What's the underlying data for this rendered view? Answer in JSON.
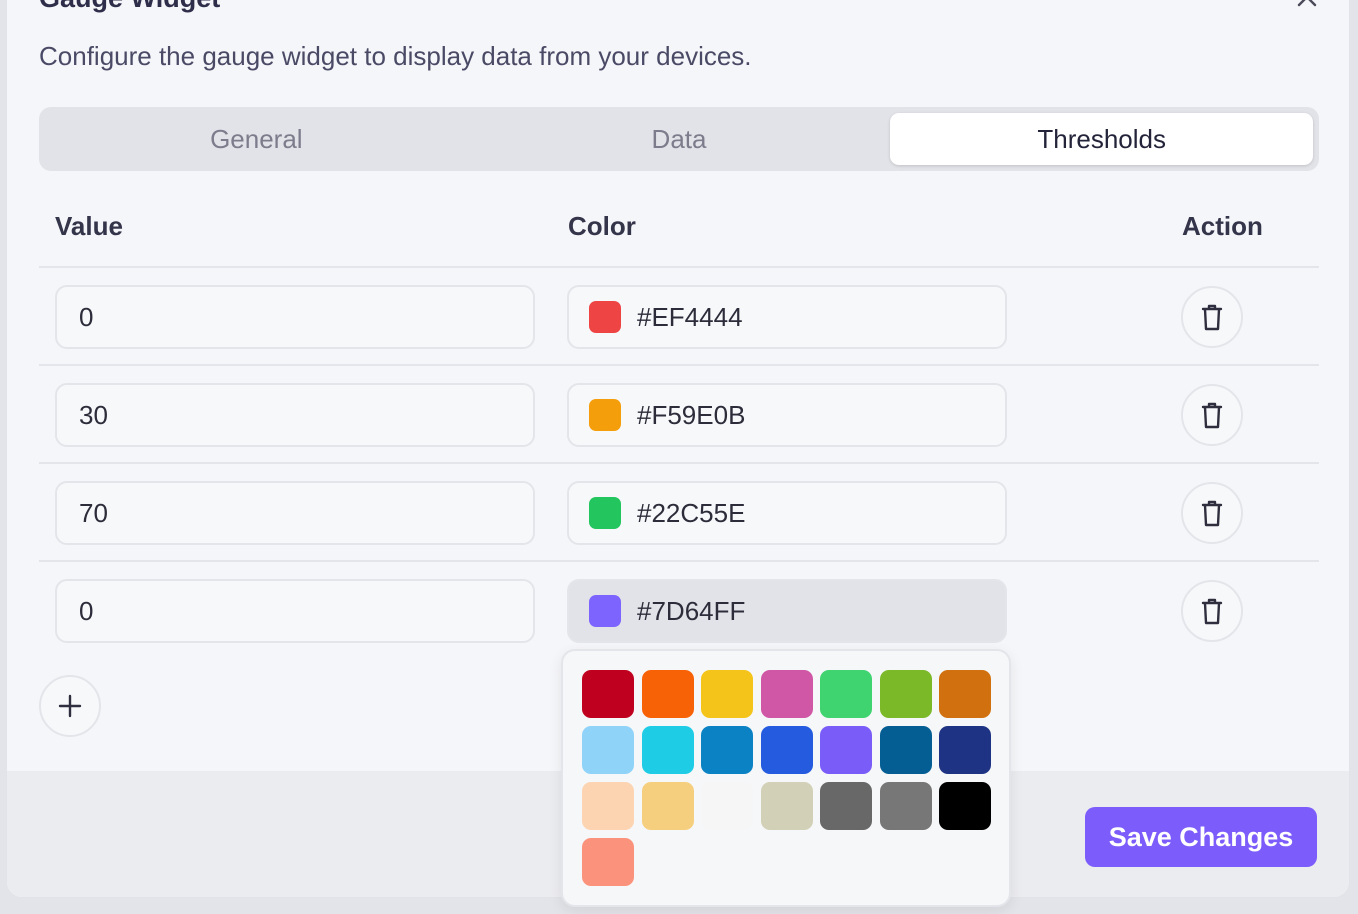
{
  "dialog": {
    "title": "Gauge Widget",
    "subtitle": "Configure the gauge widget to display data from your devices."
  },
  "tabs": [
    {
      "label": "General",
      "active": false
    },
    {
      "label": "Data",
      "active": false
    },
    {
      "label": "Thresholds",
      "active": true
    }
  ],
  "table": {
    "headers": {
      "value": "Value",
      "color": "Color",
      "action": "Action"
    },
    "rows": [
      {
        "value": "0",
        "color": "#EF4444",
        "color_label": "#EF4444"
      },
      {
        "value": "30",
        "color": "#F59E0B",
        "color_label": "#F59E0B"
      },
      {
        "value": "70",
        "color": "#22C55E",
        "color_label": "#22C55E"
      },
      {
        "value": "0",
        "color": "#7D64FF",
        "color_label": "#7D64FF"
      }
    ]
  },
  "palette": {
    "colors": [
      "#C0001F",
      "#F86207",
      "#F4C41A",
      "#CF57A6",
      "#3FD46F",
      "#7BB928",
      "#D1700E",
      "#8FD3F9",
      "#1FCCE6",
      "#0A82C4",
      "#245BDF",
      "#7A5DF9",
      "#045E93",
      "#1E3383",
      "#FDD4B1",
      "#F5CF7E",
      "#F6F6F7",
      "#D2D0B6",
      "#686868",
      "#777777",
      "#000000",
      "#FB937C"
    ]
  },
  "footer": {
    "save_label": "Save Changes"
  },
  "icons": {
    "close": "close-icon",
    "delete": "trash-icon",
    "add": "plus-icon"
  },
  "accent_color": "#7C5CFA"
}
